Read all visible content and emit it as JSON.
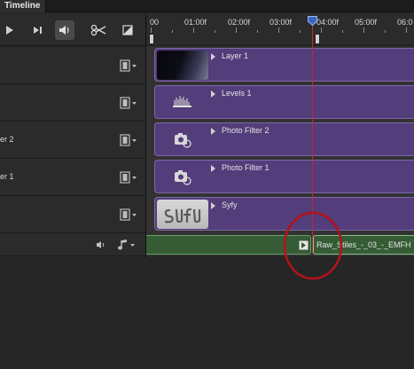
{
  "panel": {
    "title": "Timeline"
  },
  "transport": {
    "buttons": [
      {
        "name": "play-button",
        "icon": "play-icon"
      },
      {
        "name": "step-forward-button",
        "icon": "step-forward-icon"
      },
      {
        "name": "audio-toggle-button",
        "icon": "speaker-icon",
        "active": true
      },
      {
        "name": "split-clip-button",
        "icon": "scissors-icon"
      },
      {
        "name": "transition-button",
        "icon": "transition-icon"
      }
    ]
  },
  "ruler": {
    "ticks": [
      "00",
      "01:00f",
      "02:00f",
      "03:00f",
      "04:00f",
      "05:00f",
      "06:0"
    ]
  },
  "tracks": [
    {
      "name": "",
      "clip_label": "Layer 1",
      "thumb": "dark-layer"
    },
    {
      "name": "",
      "clip_label": "Levels 1",
      "thumb": "levels"
    },
    {
      "name": "er 2",
      "clip_label": "Photo Filter 2",
      "thumb": "photo-filter"
    },
    {
      "name": "er 1",
      "clip_label": "Photo Filter 1",
      "thumb": "photo-filter"
    },
    {
      "name": "",
      "clip_label": "Syfy",
      "thumb": "syfy"
    }
  ],
  "audio_track": {
    "clip_label": "Raw_Stiles_-_03_-_EMFH"
  },
  "colors": {
    "video_clip": "#533d7a",
    "audio_clip": "#355c35",
    "playhead": "#c22a2a",
    "annotation_circle": "#b3121a"
  }
}
